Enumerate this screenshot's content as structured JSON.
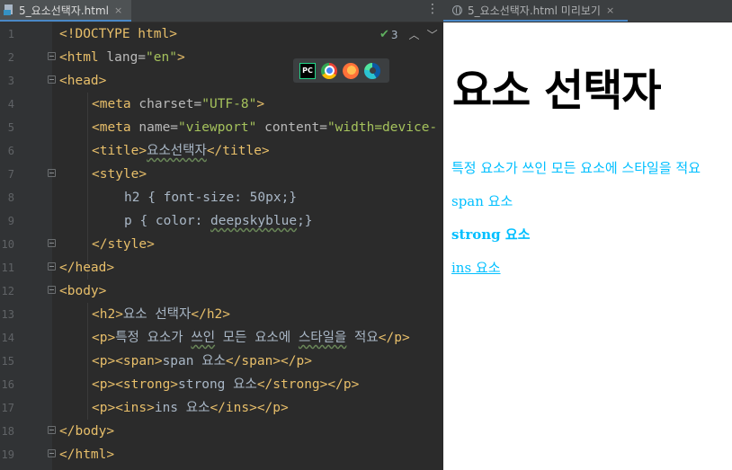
{
  "editor": {
    "tab_label": "5_요소선택자.html",
    "tab_close": "×",
    "inspection_count": "3",
    "browser_icons": [
      "pycharm-icon",
      "chrome-icon",
      "firefox-icon",
      "edge-icon"
    ],
    "line_numbers": [
      "1",
      "2",
      "3",
      "4",
      "5",
      "6",
      "7",
      "8",
      "9",
      "10",
      "11",
      "12",
      "13",
      "14",
      "15",
      "16",
      "17",
      "18",
      "19"
    ],
    "lines": {
      "l1": {
        "a": "<!DOCTYPE html>"
      },
      "l2": {
        "tag_open": "<html ",
        "attr": "lang=",
        "str": "\"en\"",
        "tag_close": ">"
      },
      "l3": {
        "tag": "<head>"
      },
      "l4": {
        "tag_open": "<meta ",
        "attr": "charset=",
        "str": "\"UTF-8\"",
        "tag_close": ">"
      },
      "l5": {
        "tag_open": "<meta ",
        "attr1": "name=",
        "str1": "\"viewport\"",
        "attr2": " content=",
        "str2": "\"width=device-"
      },
      "l6": {
        "tag_open": "<title>",
        "text": "요소선택자",
        "tag_close": "</title>"
      },
      "l7": {
        "tag": "<style>"
      },
      "l8": {
        "text": "h2 { font-size: 50px;}"
      },
      "l9": {
        "text_a": "p { color: ",
        "text_b": "deepskyblue",
        "text_c": ";}"
      },
      "l10": {
        "tag": "</style>"
      },
      "l11": {
        "tag": "</head>"
      },
      "l12": {
        "tag": "<body>"
      },
      "l13": {
        "tag_open": "<h2>",
        "text": "요소 선택자",
        "tag_close": "</h2>"
      },
      "l14": {
        "tag_open": "<p>",
        "text_a": "특정 요소가 ",
        "text_b": "쓰인",
        "text_c": " 모든 요소에 ",
        "text_d": "스타일을",
        "text_e": " 적요",
        "tag_close": "</p>"
      },
      "l15": {
        "tag_open": "<p><span>",
        "text": "span 요소",
        "tag_close": "</span></p>"
      },
      "l16": {
        "tag_open": "<p><strong>",
        "text": "strong 요소",
        "tag_close": "</strong></p>"
      },
      "l17": {
        "tag_open": "<p><ins>",
        "text": "ins 요소",
        "tag_close": "</ins></p>"
      },
      "l18": {
        "tag": "</body>"
      },
      "l19": {
        "tag": "</html>"
      }
    }
  },
  "preview": {
    "tab_label": "5_요소선택자.html 미리보기",
    "tab_close": "×",
    "heading": "요소 선택자",
    "para": "특정 요소가 쓰인 모든 요소에 스타일을 적요",
    "span_text": "span 요소",
    "strong_text": "strong 요소",
    "ins_text": "ins 요소"
  },
  "colors": {
    "editor_bg": "#2b2b2b",
    "tag": "#e8bf6a",
    "string": "#a5c25c",
    "text": "#a9b7c6",
    "preview_para": "deepskyblue",
    "tab_underline": "#4a88c7"
  }
}
